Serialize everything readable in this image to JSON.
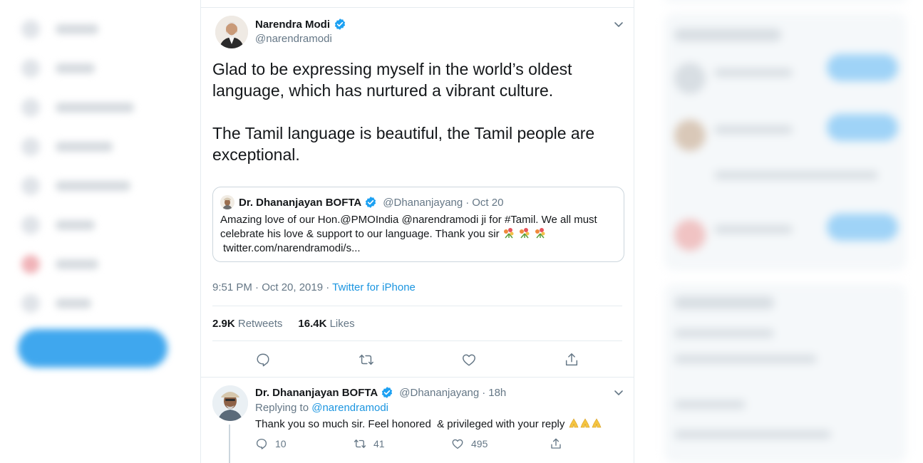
{
  "tweet": {
    "author_name": "Narendra Modi",
    "author_handle": "@narendramodi",
    "text": "Glad to be expressing myself in the world’s oldest language, which has nurtured a vibrant culture.\n\nThe Tamil language is beautiful, the Tamil people are exceptional.",
    "timestamp": "9:51 PM · Oct 20, 2019 · ",
    "source": "Twitter for iPhone",
    "retweets_count": "2.9K",
    "retweets_label": "Retweets",
    "likes_count": "16.4K",
    "likes_label": "Likes"
  },
  "quote": {
    "author_name": "Dr. Dhananjayan BOFTA",
    "author_handle": "@Dhananjayang",
    "dot": "·",
    "time": "Oct 20",
    "text_line1": "Amazing love of our Hon.@PMOIndia @narendramodi ji for #Tamil. We all must",
    "text_line2": "celebrate his love & support to our language. Thank you sir",
    "link": "twitter.com/narendramodi/s..."
  },
  "reply": {
    "author_name": "Dr. Dhananjayan BOFTA",
    "author_handle": "@Dhananjayang",
    "dot": "·",
    "time": "18h",
    "replying_label": "Replying to ",
    "replying_to": "@narendramodi",
    "text": "Thank you so much sir. Feel honored  & privileged with your reply ",
    "reply_count": "10",
    "retweet_count": "41",
    "like_count": "495"
  },
  "colors": {
    "accent": "#1b95e0",
    "verified": "#1da1f2",
    "secondary_text": "#657786"
  },
  "icons": [
    "verified-badge-icon",
    "chevron-down-icon",
    "reply-icon",
    "retweet-icon",
    "like-icon",
    "share-icon",
    "bouquet-emoji-icon",
    "folded-hands-emoji-icon"
  ]
}
